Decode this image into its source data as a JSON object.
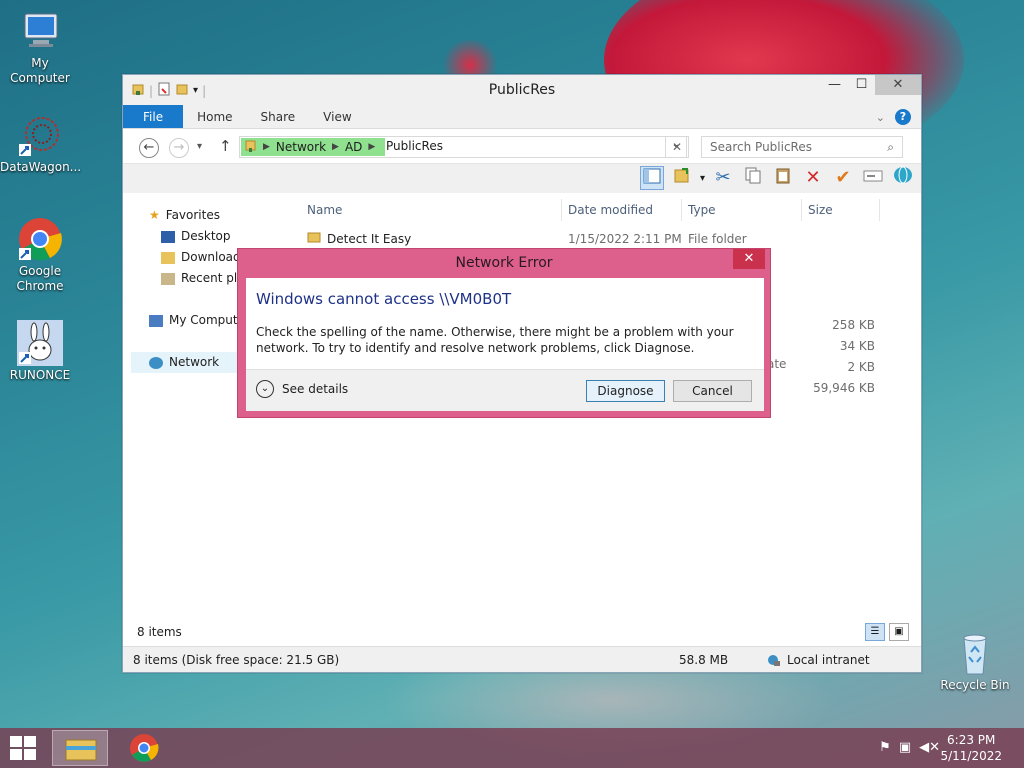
{
  "desktop": {
    "icons": [
      {
        "label": "My Computer"
      },
      {
        "label": "DataWagon..."
      },
      {
        "label": "Google Chrome"
      },
      {
        "label": "RUNONCE"
      },
      {
        "label": "Recycle Bin"
      }
    ]
  },
  "window": {
    "title": "PublicRes",
    "ribbon_tabs": [
      "File",
      "Home",
      "Share",
      "View"
    ],
    "address": {
      "segments": [
        "Network",
        "AD",
        "PublicRes"
      ]
    },
    "search": {
      "placeholder": "Search PublicRes"
    },
    "nav": {
      "favorites": "Favorites",
      "desktop": "Desktop",
      "downloads": "Downloads",
      "recent": "Recent places",
      "computer": "My Computer",
      "network": "Network"
    },
    "columns": {
      "name": "Name",
      "date": "Date modified",
      "type": "Type",
      "size": "Size"
    },
    "files": [
      {
        "name": "Detect It Easy",
        "date": "1/15/2022 2:11 PM",
        "type": "File folder"
      }
    ],
    "visible_sizes": [
      "258 KB",
      "34 KB",
      "2 KB",
      "59,946 KB"
    ],
    "type_fragment": "ate",
    "item_count": "8 items",
    "status": {
      "left": "8 items (Disk free space: 21.5 GB)",
      "size": "58.8 MB",
      "zone": "Local intranet"
    }
  },
  "dialog": {
    "title": "Network Error",
    "heading": "Windows cannot access \\\\VM0B0T",
    "message": "Check the spelling of the name. Otherwise, there might be a problem with your network. To try to identify and resolve network problems, click Diagnose.",
    "see_details": "See details",
    "diagnose": "Diagnose",
    "cancel": "Cancel"
  },
  "taskbar": {
    "time": "6:23 PM",
    "date": "5/11/2022"
  }
}
